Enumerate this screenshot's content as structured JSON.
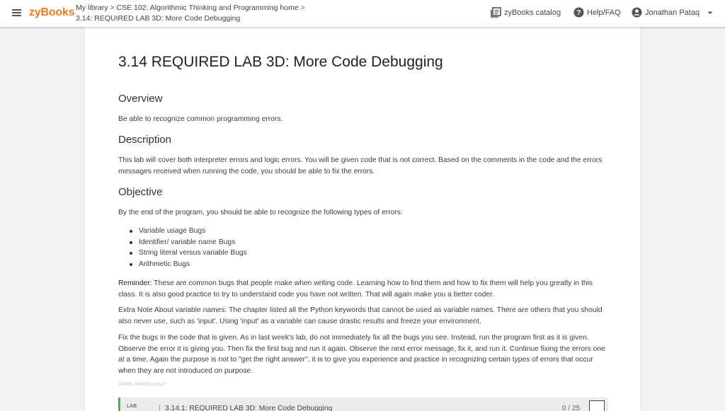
{
  "header": {
    "logo": "zyBooks",
    "breadcrumb": {
      "library": "My library",
      "sep1": " > ",
      "course": "CSE 102: Algorithmic Thinking and Programming home",
      "sep2": " >",
      "section": "3.14: REQUIRED LAB 3D: More Code Debugging"
    },
    "catalog_label": "zyBooks catalog",
    "help_label": "Help/FAQ",
    "user_name": "Jonathan Pataq"
  },
  "page": {
    "title": "3.14 REQUIRED LAB 3D: More Code Debugging",
    "overview_heading": "Overview",
    "overview_text": "Be able to recognize common programming errors.",
    "description_heading": "Description",
    "description_text": "This lab will cover both interpreter errors and logic errors. You will be given code that is not correct. Based on the comments in the code and the errors messages received when running the code, you should be able to fix the errors.",
    "objective_heading": "Objective",
    "objective_text": "By the end of the program, you should be able to recognize the following types of errors:",
    "bug_types": [
      "Variable usage Bugs",
      "Identifier/ variable name Bugs",
      "String literal versus variable Bugs",
      "Arithmetic Bugs"
    ],
    "reminder_label": "Reminder:",
    "reminder_text": " These are common bugs that people make when writing code. Learning how to find them and how to fix them will help you greatly in this class. It is also good practice to try to understand code you have not written. That will again make you a better coder.",
    "extra_note": "Extra Note About variable names: The chapter listed all the Python keywords that cannot be used as variable names. There are others that you should also never use, such as 'input'. Using 'input' as a variable can cause drastic results and freeze your environment.",
    "fix_text": "Fix the bugs in the code that is given. As in last week's lab, do not immediately fix all the bugs you see. Instead, run the program first as it is given. Observe the error it is giving you. Then fix the first bug and run it again. Observe the next error message, fix it, and run it. Continue fixing the errors one at a time. Again the purpose is not to \"get the right answer\", it is to give you experience and practice in recognizing certain types of errors that occur when they are not introduced on purpose.",
    "tiny_id": "378990.2408426.cxlzqv7"
  },
  "lab": {
    "tag": "LAB",
    "title": "3.14.1: REQUIRED LAB 3D: More Code Debugging",
    "score": "0 / 25"
  },
  "colors": {
    "brand": "#ea7d1c",
    "lab_accent": "#4caf50"
  },
  "icons": {
    "menu": "hamburger-menu-icon",
    "catalog": "book-catalog-icon",
    "help": "question-circle-icon",
    "user": "account-circle-icon",
    "dropdown": "caret-down-icon"
  }
}
